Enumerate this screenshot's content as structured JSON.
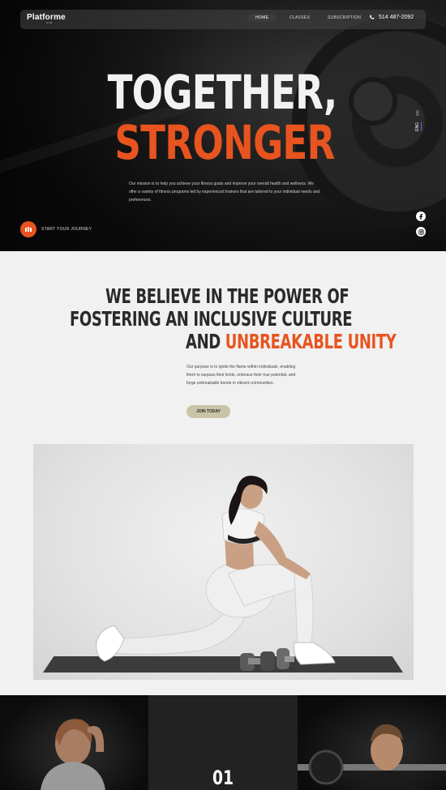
{
  "nav": {
    "logo": "Platforme",
    "logo_sub": "GYM",
    "items": [
      "HOME",
      "CLASSES",
      "SUBSCRIPTION"
    ],
    "phone": "514 487-2092"
  },
  "hero": {
    "title_line1": "TOGETHER,",
    "title_line2": "STRONGER",
    "mission": "Our mission is to help you achieve your fitness goals and improve your overall health and wellness. We offer a variety of fitness programs led by experienced trainers that are tailored to your individual needs and preferences.",
    "cta_label": "START YOUR JOURNEY",
    "languages": [
      "FR",
      "ENG"
    ]
  },
  "belief": {
    "line1": "WE BELIEVE IN THE POWER OF",
    "line2": "FOSTERING AN INCLUSIVE CULTURE",
    "line3_prefix": "AND ",
    "line3_accent": "UNBREAKABLE UNITY",
    "purpose": "Our purpose is to ignite the flame within individuals, enabling them to surpass their limits, embrace their true potential, and forge unbreakable bonds in vibrant communities.",
    "join_label": "JOIN TODAY"
  },
  "steps": {
    "number": "01"
  },
  "colors": {
    "accent": "#e8541f",
    "button": "#c9c3a8"
  }
}
